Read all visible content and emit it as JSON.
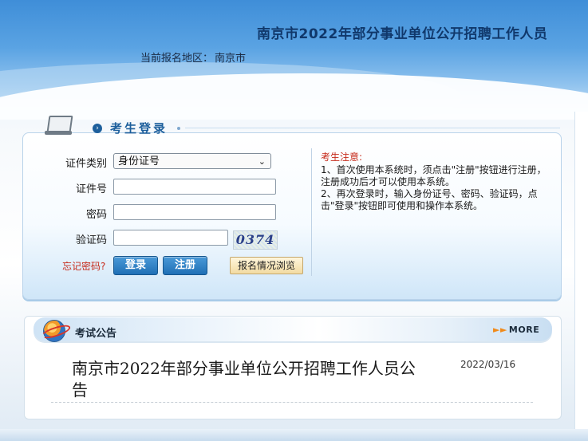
{
  "header": {
    "site_title": "南京市2022年部分事业单位公开招聘工作人员",
    "region_label": "当前报名地区：",
    "region_value": "南京市"
  },
  "login": {
    "title": "考生登录",
    "id_type_label": "证件类别",
    "id_type_value": "身份证号",
    "id_number_label": "证件号",
    "password_label": "密码",
    "captcha_label": "验证码",
    "captcha_text": "0374",
    "forgot_link": "忘记密码?",
    "login_button": "登录",
    "register_button": "注册",
    "browse_button": "报名情况浏览"
  },
  "notice": {
    "title": "考生注意:",
    "items": [
      "1、首次使用本系统时，须点击\"注册\"按钮进行注册，注册成功后才可以使用本系统。",
      "2、再次登录时，输入身份证号、密码、验证码，点击\"登录\"按钮即可使用和操作本系统。"
    ]
  },
  "announcement": {
    "title": "考试公告",
    "more_label": "MORE",
    "items": [
      {
        "title": "南京市2022年部分事业单位公开招聘工作人员公告",
        "date": "2022/03/16"
      }
    ]
  },
  "icons": {
    "monitor": "monitor-icon",
    "arrow": "arrow-circle-icon",
    "globe": "globe-icon",
    "more": "fast-forward-icon",
    "select_caret": "chevron-down-icon"
  }
}
